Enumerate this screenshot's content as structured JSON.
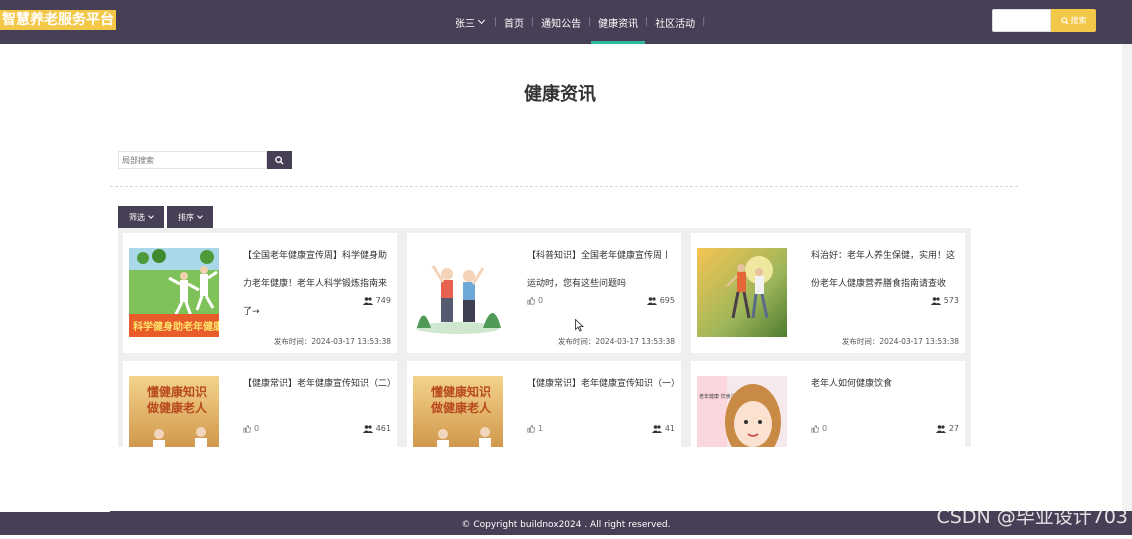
{
  "brand": "智慧养老服务平台",
  "nav": {
    "user": "张三",
    "items": [
      "首页",
      "通知公告",
      "健康资讯",
      "社区活动"
    ],
    "active_index": 2
  },
  "top_search": {
    "placeholder": "",
    "button": "搜索"
  },
  "page_title": "健康资讯",
  "local_search": {
    "placeholder": "局部搜索"
  },
  "filters": {
    "filter_label": "筛选",
    "sort_label": "排序"
  },
  "cards": [
    {
      "title": "【全国老年健康宣传周】科学健身助力老年健康！老年人科学锻炼指南来了→",
      "likes": "",
      "views": "749",
      "time": "发布时间：2024-03-17 13:53:38",
      "thumb": "taichi-green"
    },
    {
      "title": "【科普知识】全国老年健康宣传周丨运动时，您有这些问题吗",
      "likes": "0",
      "views": "695",
      "time": "发布时间：2024-03-17 13:53:38",
      "thumb": "couple-exercise"
    },
    {
      "title": "科治好：老年人养生保健，实用！这份老年人健康营养膳食指南请查收",
      "likes": "0",
      "views": "573",
      "time": "发布时间：2024-03-17 13:53:38",
      "thumb": "outdoor-photo"
    },
    {
      "title": "【健康常识】老年健康宣传知识（二）",
      "likes": "0",
      "views": "461",
      "time": "",
      "thumb": "sunset-elders"
    },
    {
      "title": "【健康常识】老年健康宣传知识（一）",
      "likes": "1",
      "views": "41",
      "time": "",
      "thumb": "sunset-elders"
    },
    {
      "title": "老年人如何健康饮食",
      "likes": "0",
      "views": "27",
      "time": "",
      "thumb": "cartoon-lady"
    }
  ],
  "thumb_texts": {
    "green_banner": "科学健身助老年健康",
    "sunset_line1": "懂健康知识",
    "sunset_line2": "做健康老人",
    "lady_note": "老年健康 饮食注意"
  },
  "footer": "© Copyright buildnox2024 . All right reserved.",
  "watermark": "CSDN @毕业设计703",
  "colors": {
    "nav_bg": "#473f55",
    "accent": "#f3c747",
    "active_underline": "#2eb99a"
  }
}
